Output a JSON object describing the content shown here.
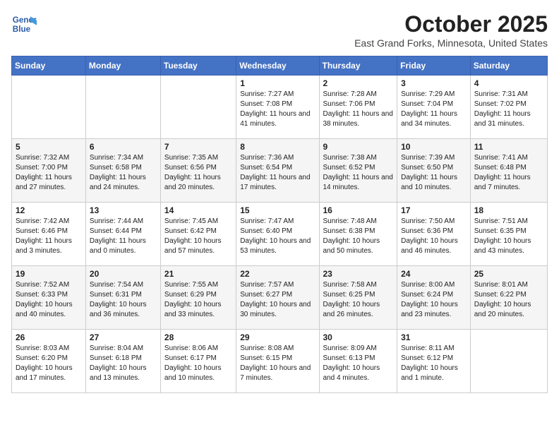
{
  "logo": {
    "line1": "General",
    "line2": "Blue"
  },
  "title": "October 2025",
  "subtitle": "East Grand Forks, Minnesota, United States",
  "days_header": [
    "Sunday",
    "Monday",
    "Tuesday",
    "Wednesday",
    "Thursday",
    "Friday",
    "Saturday"
  ],
  "weeks": [
    [
      {
        "day": "",
        "sunrise": "",
        "sunset": "",
        "daylight": ""
      },
      {
        "day": "",
        "sunrise": "",
        "sunset": "",
        "daylight": ""
      },
      {
        "day": "",
        "sunrise": "",
        "sunset": "",
        "daylight": ""
      },
      {
        "day": "1",
        "sunrise": "Sunrise: 7:27 AM",
        "sunset": "Sunset: 7:08 PM",
        "daylight": "Daylight: 11 hours and 41 minutes."
      },
      {
        "day": "2",
        "sunrise": "Sunrise: 7:28 AM",
        "sunset": "Sunset: 7:06 PM",
        "daylight": "Daylight: 11 hours and 38 minutes."
      },
      {
        "day": "3",
        "sunrise": "Sunrise: 7:29 AM",
        "sunset": "Sunset: 7:04 PM",
        "daylight": "Daylight: 11 hours and 34 minutes."
      },
      {
        "day": "4",
        "sunrise": "Sunrise: 7:31 AM",
        "sunset": "Sunset: 7:02 PM",
        "daylight": "Daylight: 11 hours and 31 minutes."
      }
    ],
    [
      {
        "day": "5",
        "sunrise": "Sunrise: 7:32 AM",
        "sunset": "Sunset: 7:00 PM",
        "daylight": "Daylight: 11 hours and 27 minutes."
      },
      {
        "day": "6",
        "sunrise": "Sunrise: 7:34 AM",
        "sunset": "Sunset: 6:58 PM",
        "daylight": "Daylight: 11 hours and 24 minutes."
      },
      {
        "day": "7",
        "sunrise": "Sunrise: 7:35 AM",
        "sunset": "Sunset: 6:56 PM",
        "daylight": "Daylight: 11 hours and 20 minutes."
      },
      {
        "day": "8",
        "sunrise": "Sunrise: 7:36 AM",
        "sunset": "Sunset: 6:54 PM",
        "daylight": "Daylight: 11 hours and 17 minutes."
      },
      {
        "day": "9",
        "sunrise": "Sunrise: 7:38 AM",
        "sunset": "Sunset: 6:52 PM",
        "daylight": "Daylight: 11 hours and 14 minutes."
      },
      {
        "day": "10",
        "sunrise": "Sunrise: 7:39 AM",
        "sunset": "Sunset: 6:50 PM",
        "daylight": "Daylight: 11 hours and 10 minutes."
      },
      {
        "day": "11",
        "sunrise": "Sunrise: 7:41 AM",
        "sunset": "Sunset: 6:48 PM",
        "daylight": "Daylight: 11 hours and 7 minutes."
      }
    ],
    [
      {
        "day": "12",
        "sunrise": "Sunrise: 7:42 AM",
        "sunset": "Sunset: 6:46 PM",
        "daylight": "Daylight: 11 hours and 3 minutes."
      },
      {
        "day": "13",
        "sunrise": "Sunrise: 7:44 AM",
        "sunset": "Sunset: 6:44 PM",
        "daylight": "Daylight: 11 hours and 0 minutes."
      },
      {
        "day": "14",
        "sunrise": "Sunrise: 7:45 AM",
        "sunset": "Sunset: 6:42 PM",
        "daylight": "Daylight: 10 hours and 57 minutes."
      },
      {
        "day": "15",
        "sunrise": "Sunrise: 7:47 AM",
        "sunset": "Sunset: 6:40 PM",
        "daylight": "Daylight: 10 hours and 53 minutes."
      },
      {
        "day": "16",
        "sunrise": "Sunrise: 7:48 AM",
        "sunset": "Sunset: 6:38 PM",
        "daylight": "Daylight: 10 hours and 50 minutes."
      },
      {
        "day": "17",
        "sunrise": "Sunrise: 7:50 AM",
        "sunset": "Sunset: 6:36 PM",
        "daylight": "Daylight: 10 hours and 46 minutes."
      },
      {
        "day": "18",
        "sunrise": "Sunrise: 7:51 AM",
        "sunset": "Sunset: 6:35 PM",
        "daylight": "Daylight: 10 hours and 43 minutes."
      }
    ],
    [
      {
        "day": "19",
        "sunrise": "Sunrise: 7:52 AM",
        "sunset": "Sunset: 6:33 PM",
        "daylight": "Daylight: 10 hours and 40 minutes."
      },
      {
        "day": "20",
        "sunrise": "Sunrise: 7:54 AM",
        "sunset": "Sunset: 6:31 PM",
        "daylight": "Daylight: 10 hours and 36 minutes."
      },
      {
        "day": "21",
        "sunrise": "Sunrise: 7:55 AM",
        "sunset": "Sunset: 6:29 PM",
        "daylight": "Daylight: 10 hours and 33 minutes."
      },
      {
        "day": "22",
        "sunrise": "Sunrise: 7:57 AM",
        "sunset": "Sunset: 6:27 PM",
        "daylight": "Daylight: 10 hours and 30 minutes."
      },
      {
        "day": "23",
        "sunrise": "Sunrise: 7:58 AM",
        "sunset": "Sunset: 6:25 PM",
        "daylight": "Daylight: 10 hours and 26 minutes."
      },
      {
        "day": "24",
        "sunrise": "Sunrise: 8:00 AM",
        "sunset": "Sunset: 6:24 PM",
        "daylight": "Daylight: 10 hours and 23 minutes."
      },
      {
        "day": "25",
        "sunrise": "Sunrise: 8:01 AM",
        "sunset": "Sunset: 6:22 PM",
        "daylight": "Daylight: 10 hours and 20 minutes."
      }
    ],
    [
      {
        "day": "26",
        "sunrise": "Sunrise: 8:03 AM",
        "sunset": "Sunset: 6:20 PM",
        "daylight": "Daylight: 10 hours and 17 minutes."
      },
      {
        "day": "27",
        "sunrise": "Sunrise: 8:04 AM",
        "sunset": "Sunset: 6:18 PM",
        "daylight": "Daylight: 10 hours and 13 minutes."
      },
      {
        "day": "28",
        "sunrise": "Sunrise: 8:06 AM",
        "sunset": "Sunset: 6:17 PM",
        "daylight": "Daylight: 10 hours and 10 minutes."
      },
      {
        "day": "29",
        "sunrise": "Sunrise: 8:08 AM",
        "sunset": "Sunset: 6:15 PM",
        "daylight": "Daylight: 10 hours and 7 minutes."
      },
      {
        "day": "30",
        "sunrise": "Sunrise: 8:09 AM",
        "sunset": "Sunset: 6:13 PM",
        "daylight": "Daylight: 10 hours and 4 minutes."
      },
      {
        "day": "31",
        "sunrise": "Sunrise: 8:11 AM",
        "sunset": "Sunset: 6:12 PM",
        "daylight": "Daylight: 10 hours and 1 minute."
      },
      {
        "day": "",
        "sunrise": "",
        "sunset": "",
        "daylight": ""
      }
    ]
  ]
}
